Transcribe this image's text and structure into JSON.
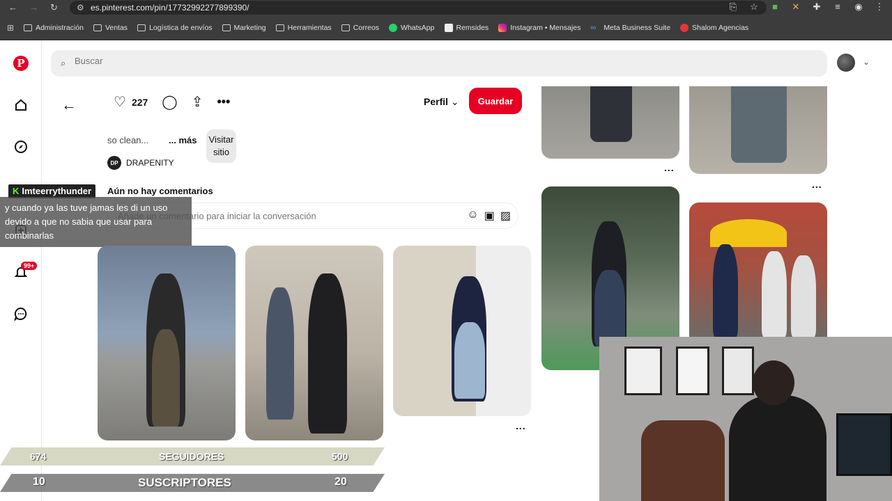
{
  "browser": {
    "url": "es.pinterest.com/pin/17732992277899390/",
    "bookmarks": [
      {
        "label": "Administración",
        "icon": "folder-icon"
      },
      {
        "label": "Ventas",
        "icon": "folder-icon"
      },
      {
        "label": "Logística de envíos",
        "icon": "folder-icon"
      },
      {
        "label": "Marketing",
        "icon": "folder-icon"
      },
      {
        "label": "Herramientas",
        "icon": "folder-icon"
      },
      {
        "label": "Correos",
        "icon": "folder-icon"
      },
      {
        "label": "WhatsApp",
        "icon": "whatsapp-icon"
      },
      {
        "label": "Remsides",
        "icon": "remsides-icon"
      },
      {
        "label": "Instagram • Mensajes",
        "icon": "instagram-icon"
      },
      {
        "label": "Meta Business Suite",
        "icon": "meta-icon"
      },
      {
        "label": "Shalom Agencias",
        "icon": "shalom-icon"
      }
    ]
  },
  "pinterest": {
    "search_placeholder": "Buscar",
    "notifications_badge": "99+",
    "like_count": "227",
    "perfil_label": "Perfil",
    "guardar_label": "Guardar",
    "description": "so clean...",
    "more_label": "... más",
    "visit_label_1": "Visitar",
    "visit_label_2": "sitio",
    "creator_logo": "DP",
    "creator_name": "DRAPENITY",
    "no_comments": "Aún no hay comentarios",
    "comment_placeholder": "Añade un comentario para iniciar la conversación",
    "more_dots": "..."
  },
  "chat": {
    "username": "Imteerrythunder",
    "message": "y cuando ya las tuve jamas les di un uso devido a que no sabia que usar para combinarlas"
  },
  "stream_stats": {
    "followers": {
      "current": "674",
      "label": "SEGUIDORES",
      "goal": "500"
    },
    "subscribers": {
      "current": "10",
      "label": "SUSCRIPTORES",
      "goal": "20"
    }
  },
  "colors": {
    "pinterest_red": "#e60023",
    "kick_green": "#53fc18"
  }
}
